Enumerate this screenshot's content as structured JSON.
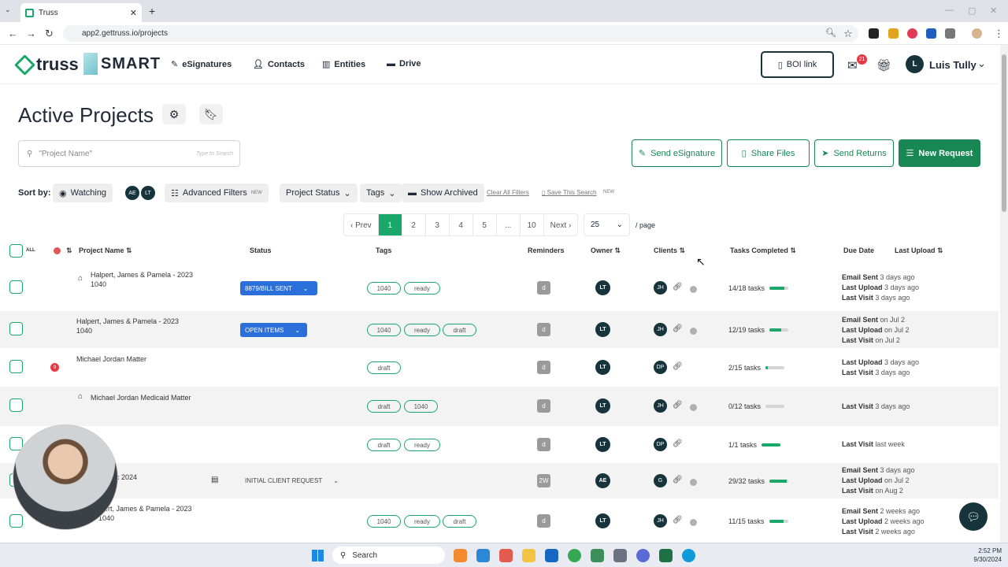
{
  "browser": {
    "tab_title": "Truss",
    "url": "app2.gettruss.io/projects"
  },
  "header": {
    "logo_text": "truss",
    "smart_text": "SMART",
    "nav": [
      "eSignatures",
      "Contacts",
      "Entities",
      "Drive"
    ],
    "boi_label": "BOI link",
    "inbox_count": "21",
    "user_initial": "L",
    "user_name": "Luis Tully"
  },
  "page": {
    "title": "Active Projects",
    "search_placeholder": "\"Project Name\"",
    "search_hint": "Type to Search",
    "actions": {
      "send_esignature": "Send eSignature",
      "share_files": "Share Files",
      "send_returns": "Send Returns",
      "new_request": "New Request"
    }
  },
  "filters": {
    "sort_by": "Sort by:",
    "watching": "Watching",
    "avatars": [
      "AE",
      "LT"
    ],
    "advanced_filters": "Advanced Filters",
    "new_tag": "NEW",
    "project_status": "Project Status",
    "tags": "Tags",
    "show_archived": "Show Archived",
    "clear_all": "Clear All Filters",
    "save_search": "Save This Search"
  },
  "pagination": {
    "prev": "‹ Prev",
    "pages": [
      "1",
      "2",
      "3",
      "4",
      "5",
      "...",
      "10"
    ],
    "next": "Next ›",
    "per_page": "25",
    "per_page_label": "/ page"
  },
  "table": {
    "all_label": "ALL",
    "columns": [
      "Project Name",
      "Status",
      "Tags",
      "Reminders",
      "Owner",
      "Clients",
      "Tasks Completed",
      "Due Date",
      "Last Upload"
    ],
    "rows": [
      {
        "name": [
          "Halpert, James & Pamela - 2023",
          "1040"
        ],
        "status": "8879/BILL SENT",
        "tags": [
          "1040",
          "ready"
        ],
        "reminder": "d",
        "owner": "LT",
        "client": "JH",
        "tasks": "14/18 tasks",
        "progress": 0.78,
        "activity": [
          [
            "Email Sent",
            "3 days ago"
          ],
          [
            "Last Upload",
            "3 days ago"
          ],
          [
            "Last Visit",
            "3 days ago"
          ]
        ]
      },
      {
        "name": [
          "Halpert, James & Pamela - 2023",
          "1040"
        ],
        "status": "OPEN ITEMS",
        "tags": [
          "1040",
          "ready",
          "draft"
        ],
        "reminder": "d",
        "owner": "LT",
        "client": "JH",
        "tasks": "12/19 tasks",
        "progress": 0.63,
        "activity": [
          [
            "Email Sent",
            "on Jul 2"
          ],
          [
            "Last Upload",
            "on Jul 2"
          ],
          [
            "Last Visit",
            "on Jul 2"
          ]
        ]
      },
      {
        "name": [
          "Michael Jordan Matter"
        ],
        "notif": "9",
        "tags": [
          "draft"
        ],
        "reminder": "d",
        "owner": "LT",
        "client": "DP",
        "tasks": "2/15 tasks",
        "progress": 0.13,
        "activity": [
          [
            "Last Upload",
            "3 days ago"
          ],
          [
            "Last Visit",
            "3 days ago"
          ]
        ]
      },
      {
        "name": [
          "Michael Jordan Medicaid Matter"
        ],
        "tags": [
          "draft",
          "1040"
        ],
        "reminder": "d",
        "owner": "LT",
        "client": "JH",
        "tasks": "0/12 tasks",
        "progress": 0,
        "activity": [
          [
            "Last Visit",
            "3 days ago"
          ]
        ]
      },
      {
        "name": [],
        "tags": [
          "draft",
          "ready"
        ],
        "reminder": "d",
        "owner": "LT",
        "client": "DP",
        "tasks": "1/1 tasks",
        "progress": 1,
        "activity": [
          [
            "Last Visit",
            "last week"
          ]
        ]
      },
      {
        "name": [
          "c 2024"
        ],
        "status": "INITIAL CLIENT REQUEST",
        "tags": [],
        "reminder": "2W",
        "owner": "AE",
        "client": "G",
        "tasks": "29/32 tasks",
        "progress": 0.9,
        "activity": [
          [
            "Email Sent",
            "3 days ago"
          ],
          [
            "Last Upload",
            "on Jul 2"
          ],
          [
            "Last Visit",
            "on Aug 2"
          ]
        ]
      },
      {
        "name": [
          "lpert, James & Pamela - 2023",
          "1040"
        ],
        "tags": [
          "1040",
          "ready",
          "draft"
        ],
        "reminder": "d",
        "owner": "LT",
        "client": "JH",
        "tasks": "11/15 tasks",
        "progress": 0.73,
        "activity": [
          [
            "Email Sent",
            "2 weeks ago"
          ],
          [
            "Last Upload",
            "2 weeks ago"
          ],
          [
            "Last Visit",
            "2 weeks ago"
          ]
        ]
      }
    ]
  },
  "taskbar": {
    "search": "Search",
    "time": "2:52 PM",
    "date": "9/30/2024"
  },
  "colors": {
    "brand_green": "#1aa86a",
    "status_blue": "#2b6fdb",
    "dark_navy": "#17343c"
  }
}
